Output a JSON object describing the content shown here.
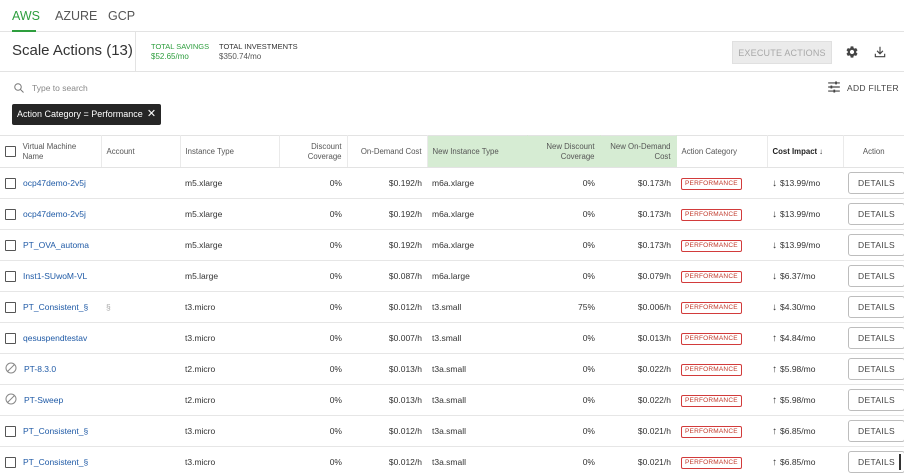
{
  "tabs": [
    {
      "label": "AWS",
      "active": true
    },
    {
      "label": "AZURE",
      "active": false
    },
    {
      "label": "GCP",
      "active": false
    }
  ],
  "header": {
    "title": "Scale Actions (13)",
    "total_savings_label": "TOTAL SAVINGS",
    "total_savings_value": "$52.65/mo",
    "total_investments_label": "TOTAL INVESTMENTS",
    "total_investments_value": "$350.74/mo",
    "execute_label": "EXECUTE ACTIONS",
    "settings_icon": "gear-icon",
    "download_icon": "download-icon"
  },
  "search": {
    "placeholder": "Type to search",
    "add_filter_label": "ADD FILTER"
  },
  "filter_chip": {
    "label": "Action Category = Performance",
    "close": "✕"
  },
  "table": {
    "columns": {
      "vm_name": "Virtual Machine Name",
      "account": "Account",
      "instance_type": "Instance Type",
      "discount_coverage": "Discount Coverage",
      "on_demand_cost": "On-Demand Cost",
      "new_instance_type": "New Instance Type",
      "new_discount_coverage": "New Discount Coverage",
      "new_on_demand_cost": "New On-Demand Cost",
      "action_category": "Action Category",
      "cost_impact": "Cost Impact ↓",
      "action": "Action"
    },
    "rows": [
      {
        "select": "checkbox",
        "vm": "ocp47demo-2v5j",
        "account": "",
        "type": "m5.xlarge",
        "disc": "0%",
        "cost": "$0.192/h",
        "new_type": "m6a.xlarge",
        "new_disc": "0%",
        "new_cost": "$0.173/h",
        "category": "PERFORMANCE",
        "dir": "↓",
        "impact": "$13.99/mo",
        "action": "DETAILS"
      },
      {
        "select": "checkbox",
        "vm": "ocp47demo-2v5j",
        "account": "",
        "type": "m5.xlarge",
        "disc": "0%",
        "cost": "$0.192/h",
        "new_type": "m6a.xlarge",
        "new_disc": "0%",
        "new_cost": "$0.173/h",
        "category": "PERFORMANCE",
        "dir": "↓",
        "impact": "$13.99/mo",
        "action": "DETAILS"
      },
      {
        "select": "checkbox",
        "vm": "PT_OVA_automa",
        "account": "",
        "type": "m5.xlarge",
        "disc": "0%",
        "cost": "$0.192/h",
        "new_type": "m6a.xlarge",
        "new_disc": "0%",
        "new_cost": "$0.173/h",
        "category": "PERFORMANCE",
        "dir": "↓",
        "impact": "$13.99/mo",
        "action": "DETAILS"
      },
      {
        "select": "checkbox",
        "vm": "Inst1-SUwoM-VL",
        "account": "",
        "type": "m5.large",
        "disc": "0%",
        "cost": "$0.087/h",
        "new_type": "m6a.large",
        "new_disc": "0%",
        "new_cost": "$0.079/h",
        "category": "PERFORMANCE",
        "dir": "↓",
        "impact": "$6.37/mo",
        "action": "DETAILS"
      },
      {
        "select": "checkbox",
        "vm": "PT_Consistent_§",
        "account": "§",
        "type": "t3.micro",
        "disc": "0%",
        "cost": "$0.012/h",
        "new_type": "t3.small",
        "new_disc": "75%",
        "new_cost": "$0.006/h",
        "category": "PERFORMANCE",
        "dir": "↓",
        "impact": "$4.30/mo",
        "action": "DETAILS"
      },
      {
        "select": "checkbox",
        "vm": "qesuspendtestav",
        "account": "",
        "type": "t3.micro",
        "disc": "0%",
        "cost": "$0.007/h",
        "new_type": "t3.small",
        "new_disc": "0%",
        "new_cost": "$0.013/h",
        "category": "PERFORMANCE",
        "dir": "↑",
        "impact": "$4.84/mo",
        "action": "DETAILS"
      },
      {
        "select": "disabled",
        "vm": "PT-8.3.0",
        "account": "",
        "type": "t2.micro",
        "disc": "0%",
        "cost": "$0.013/h",
        "new_type": "t3a.small",
        "new_disc": "0%",
        "new_cost": "$0.022/h",
        "category": "PERFORMANCE",
        "dir": "↑",
        "impact": "$5.98/mo",
        "action": "DETAILS"
      },
      {
        "select": "disabled",
        "vm": "PT-Sweep",
        "account": "",
        "type": "t2.micro",
        "disc": "0%",
        "cost": "$0.013/h",
        "new_type": "t3a.small",
        "new_disc": "0%",
        "new_cost": "$0.022/h",
        "category": "PERFORMANCE",
        "dir": "↑",
        "impact": "$5.98/mo",
        "action": "DETAILS"
      },
      {
        "select": "checkbox",
        "vm": "PT_Consistent_§",
        "account": "",
        "type": "t3.micro",
        "disc": "0%",
        "cost": "$0.012/h",
        "new_type": "t3a.small",
        "new_disc": "0%",
        "new_cost": "$0.021/h",
        "category": "PERFORMANCE",
        "dir": "↑",
        "impact": "$6.85/mo",
        "action": "DETAILS"
      },
      {
        "select": "checkbox",
        "vm": "PT_Consistent_§",
        "account": "",
        "type": "t3.micro",
        "disc": "0%",
        "cost": "$0.012/h",
        "new_type": "t3a.small",
        "new_disc": "0%",
        "new_cost": "$0.021/h",
        "category": "PERFORMANCE",
        "dir": "↑",
        "impact": "$6.85/mo",
        "action": "DETAILS"
      }
    ]
  },
  "colors": {
    "accent_green": "#2e9e3e",
    "new_columns_bg": "#d6ecd3",
    "badge_red": "#c0392b",
    "link_blue": "#1f5aa6"
  }
}
